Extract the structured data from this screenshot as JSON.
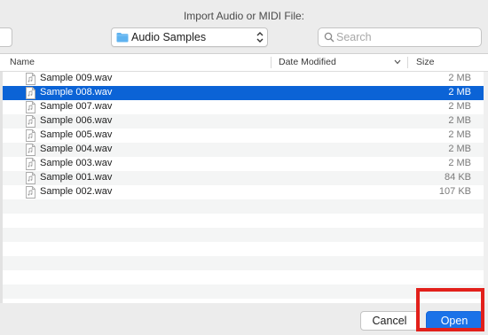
{
  "dialog": {
    "title": "Import Audio or MIDI File:"
  },
  "toolbar": {
    "location_label": "Audio Samples",
    "search_placeholder": "Search"
  },
  "columns": {
    "name": "Name",
    "date_modified": "Date Modified",
    "size": "Size"
  },
  "files": [
    {
      "name": "Sample 009.wav",
      "size": "2 MB"
    },
    {
      "name": "Sample 008.wav",
      "size": "2 MB",
      "selected": true
    },
    {
      "name": "Sample 007.wav",
      "size": "2 MB"
    },
    {
      "name": "Sample 006.wav",
      "size": "2 MB"
    },
    {
      "name": "Sample 005.wav",
      "size": "2 MB"
    },
    {
      "name": "Sample 004.wav",
      "size": "2 MB"
    },
    {
      "name": "Sample 003.wav",
      "size": "2 MB"
    },
    {
      "name": "Sample 001.wav",
      "size": "84 KB"
    },
    {
      "name": "Sample 002.wav",
      "size": "107 KB"
    }
  ],
  "buttons": {
    "cancel": "Cancel",
    "open": "Open"
  },
  "colors": {
    "selection": "#0b63d6",
    "primary_button": "#1b72e8",
    "highlight": "#e2201b",
    "folder": "#5fb3f0"
  },
  "icons": {
    "folder": "folder-icon",
    "search": "search-icon",
    "file": "audio-file-icon",
    "sort": "chevron-down-icon"
  }
}
